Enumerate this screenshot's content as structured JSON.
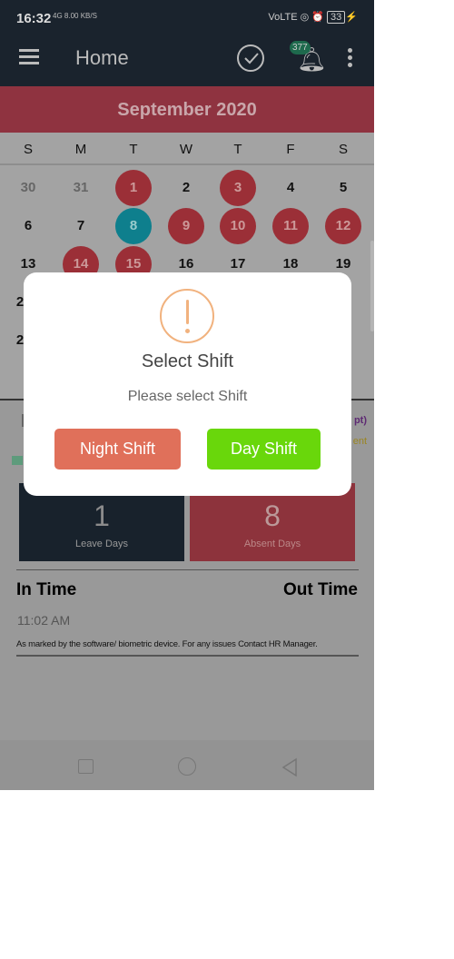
{
  "status_bar": {
    "time": "16:32",
    "network": "4G  8.00 KB/S",
    "battery": "33"
  },
  "app_bar": {
    "title": "Home",
    "notification_count": "377",
    "icons": [
      "menu-icon",
      "check-circle-icon",
      "bell-icon",
      "more-vert-icon"
    ]
  },
  "calendar": {
    "month": "September 2020",
    "weekdays": [
      "S",
      "M",
      "T",
      "W",
      "T",
      "F",
      "S"
    ],
    "rows": [
      [
        {
          "d": "30",
          "s": "other"
        },
        {
          "d": "31",
          "s": "other"
        },
        {
          "d": "1",
          "s": "absent"
        },
        {
          "d": "2",
          "s": "normal"
        },
        {
          "d": "3",
          "s": "absent"
        },
        {
          "d": "4",
          "s": "normal"
        },
        {
          "d": "5",
          "s": "normal"
        }
      ],
      [
        {
          "d": "6",
          "s": "normal"
        },
        {
          "d": "7",
          "s": "normal"
        },
        {
          "d": "8",
          "s": "today"
        },
        {
          "d": "9",
          "s": "absent"
        },
        {
          "d": "10",
          "s": "absent"
        },
        {
          "d": "11",
          "s": "absent"
        },
        {
          "d": "12",
          "s": "absent"
        }
      ],
      [
        {
          "d": "13",
          "s": "normal"
        },
        {
          "d": "14",
          "s": "absent"
        },
        {
          "d": "15",
          "s": "absent"
        },
        {
          "d": "16",
          "s": "normal"
        },
        {
          "d": "17",
          "s": "normal"
        },
        {
          "d": "18",
          "s": "normal"
        },
        {
          "d": "19",
          "s": "normal"
        }
      ],
      [
        {
          "d": "2",
          "s": "normal"
        }
      ],
      [
        {
          "d": "2",
          "s": "normal"
        }
      ]
    ],
    "colors": {
      "absent": "#9b2f37",
      "today": "#0e7f8d"
    }
  },
  "legend": {
    "fragment_a": "pt)",
    "fragment_b": "ent"
  },
  "stats": {
    "leave_count": "1",
    "leave_label": "Leave Days",
    "absent_count": "8",
    "absent_label": "Absent Days"
  },
  "attendance": {
    "in_label": "In Time",
    "out_label": "Out Time",
    "in_value": "11:02 AM",
    "note": "As marked by the software/ biometric device. For any issues Contact HR Manager."
  },
  "dialog": {
    "icon": "warning-icon",
    "title": "Select Shift",
    "message": "Please select Shift",
    "night_label": "Night Shift",
    "day_label": "Day Shift",
    "night_color": "#e0705a",
    "day_color": "#69d70b"
  }
}
